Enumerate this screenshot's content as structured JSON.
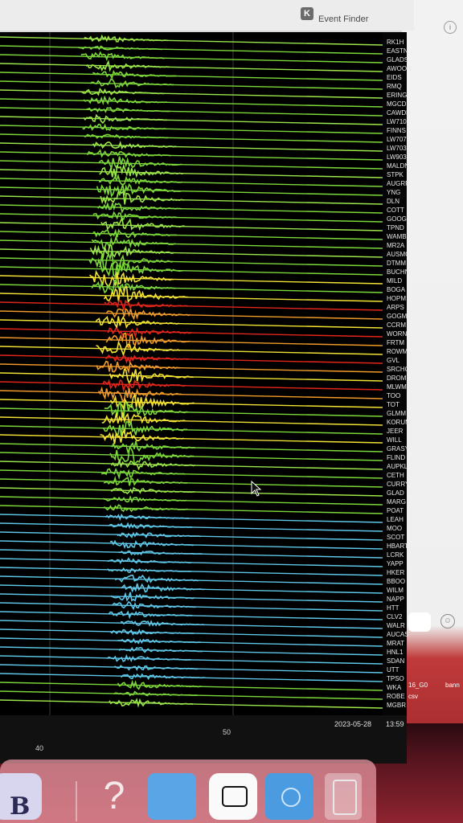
{
  "window": {
    "title": "Event Finder",
    "title_icon": "K"
  },
  "stations": [
    "RK1H",
    "EASTN",
    "GLADS",
    "AWOON",
    "EIDS",
    "RMQ",
    "ERING",
    "MGCD",
    "CAWDR",
    "LW710",
    "FINNS",
    "LW707",
    "LW703",
    "LW903",
    "MALDN",
    "STPK",
    "AUGRF",
    "YNG",
    "DLN",
    "COTT",
    "GOOG",
    "TPND",
    "WAMB",
    "MR2A",
    "AUSMG",
    "DTMM",
    "BUCHN",
    "MILD",
    "BOGA",
    "HOPM",
    "ARPS",
    "GOGM",
    "CCRM",
    "WORN",
    "FRTM",
    "ROWM",
    "GVL",
    "SRCHQ",
    "DROM",
    "MLWM",
    "TOO",
    "TOT",
    "GLMM",
    "KORUM",
    "JEER",
    "WILL",
    "GRASY",
    "FLIND",
    "AUPKL",
    "CETH",
    "CURRY",
    "GLAD",
    "MARG",
    "POAT",
    "LEAH",
    "MOO",
    "SCOT",
    "HBART",
    "LCRK",
    "YAPP",
    "HKER",
    "BBOO",
    "WILM",
    "NAPP",
    "HTT",
    "CLV2",
    "WALR",
    "AUCAS",
    "MRAT",
    "HNL1",
    "SDAN",
    "UTT",
    "TPSO",
    "WKA",
    "ROBE",
    "MGBR"
  ],
  "axis": {
    "tick_40": "40",
    "tick_50": "50",
    "date": "2023-05-28",
    "time": "13:59"
  },
  "colors": {
    "green": "#7cd83a",
    "light_green": "#9be64a",
    "yellow": "#f2e234",
    "orange": "#f09a2a",
    "red": "#e2261b",
    "cyan": "#5ec6e6",
    "grid": "#3a3a3a"
  },
  "side": {
    "file_a": "16_G0",
    "file_b": "bann",
    "file_c": "csv"
  },
  "dock": {
    "finder_icon": "finder-icon",
    "help_glyph": "?",
    "folder_icon": "folder-icon",
    "screenshot_icon": "screenshot-icon",
    "downloads_icon": "downloads-icon",
    "trash_icon": "trash-icon"
  }
}
